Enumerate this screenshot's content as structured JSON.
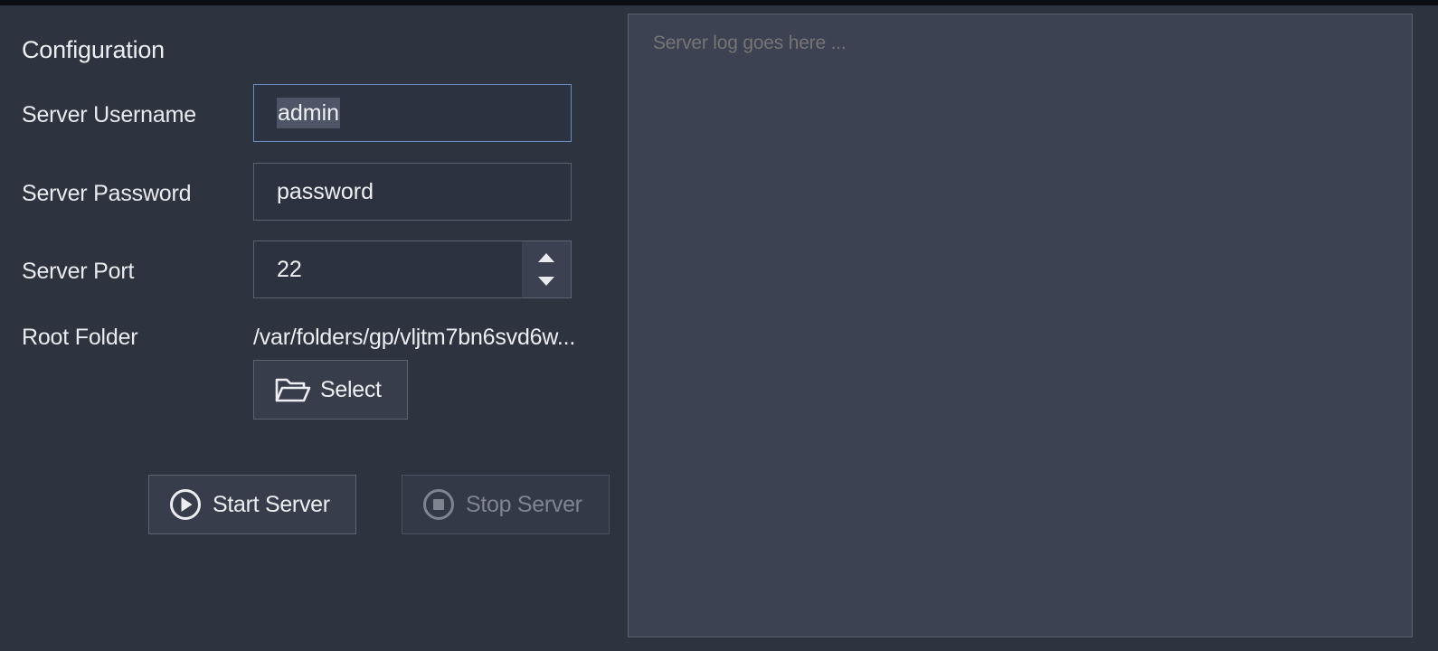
{
  "config": {
    "title": "Configuration",
    "username": {
      "label": "Server Username",
      "value": "admin"
    },
    "password": {
      "label": "Server Password",
      "value": "password"
    },
    "port": {
      "label": "Server Port",
      "value": "22"
    },
    "root_folder": {
      "label": "Root Folder",
      "value": "/var/folders/gp/vljtm7bn6svd6w...",
      "select_label": "Select"
    }
  },
  "actions": {
    "start_label": "Start Server",
    "stop_label": "Stop Server",
    "stop_enabled": false
  },
  "log": {
    "placeholder": "Server log goes here ..."
  },
  "icons": {
    "select": "folder-open-icon",
    "start": "play-circle-icon",
    "stop": "stop-circle-icon",
    "spinner_up": "triangle-up-icon",
    "spinner_down": "triangle-down-icon"
  },
  "colors": {
    "panel_background": "#2e3340",
    "field_background": "#2d3240",
    "log_background": "#3c4252",
    "focus_border": "#6a8fbf",
    "disabled_text": "#7f8491"
  }
}
